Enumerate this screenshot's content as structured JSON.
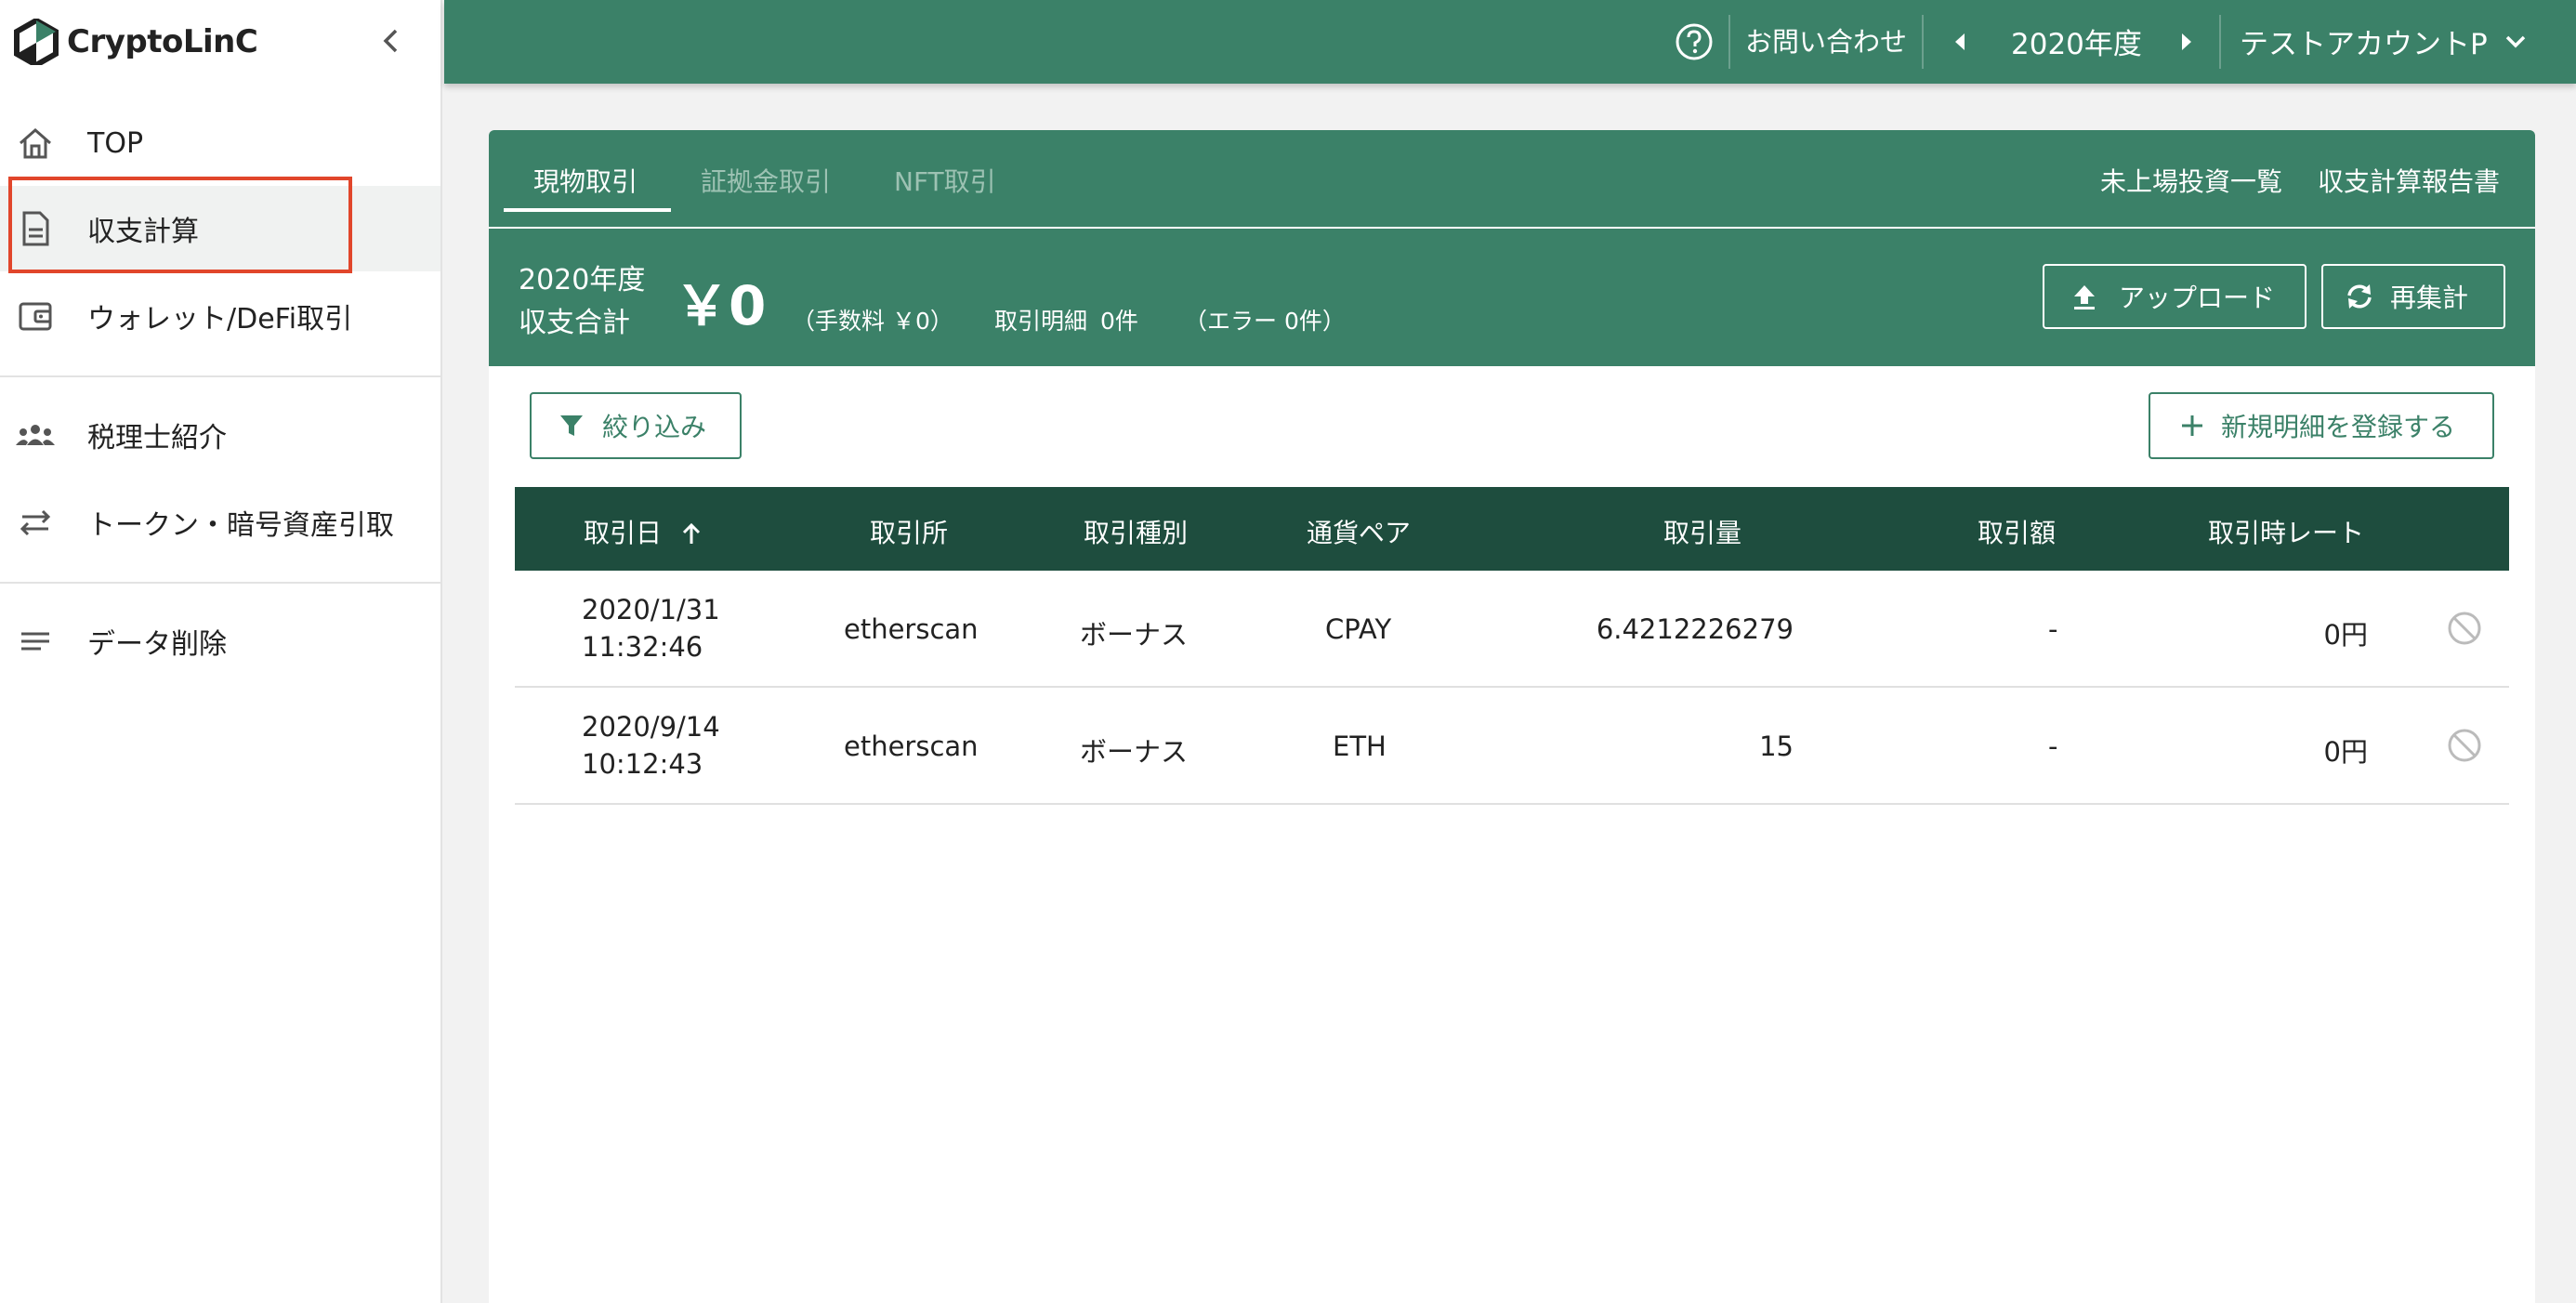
{
  "app": {
    "logo_text": "CryptoLinC"
  },
  "sidebar": {
    "items": [
      {
        "label": "TOP",
        "icon": "home-icon"
      },
      {
        "label": "収支計算",
        "icon": "document-icon"
      },
      {
        "label": "ウォレット/DeFi取引",
        "icon": "wallet-icon"
      },
      {
        "label": "税理士紹介",
        "icon": "people-icon"
      },
      {
        "label": "トークン・暗号資産引取",
        "icon": "swap-icon"
      },
      {
        "label": "データ削除",
        "icon": "lines-icon"
      }
    ],
    "active_item": "収支計算",
    "highlight_color": "#e1462b"
  },
  "topbar": {
    "contact": "お問い合わせ",
    "year": "2020年度",
    "account": "テストアカウントP"
  },
  "tabs": {
    "items": [
      "現物取引",
      "証拠金取引",
      "NFT取引"
    ],
    "active": "現物取引",
    "right_links": [
      "未上場投資一覧",
      "収支計算報告書"
    ]
  },
  "summary": {
    "year_label": "2020年度",
    "total_label": "収支合計",
    "total_value": "￥0",
    "fee_text": "（手数料 ￥0）",
    "count_label": "取引明細",
    "count_value": "0件",
    "error_text": "（エラー 0件）",
    "upload_label": "アップロード",
    "recalc_label": "再集計"
  },
  "actions": {
    "filter_label": "絞り込み",
    "register_label": "新規明細を登録する"
  },
  "table": {
    "headers": [
      "取引日",
      "取引所",
      "取引種別",
      "通貨ペア",
      "取引量",
      "取引額",
      "取引時レート"
    ],
    "rows": [
      {
        "date": "2020/1/31",
        "time": "11:32:46",
        "exchange": "etherscan",
        "type": "ボーナス",
        "pair": "CPAY",
        "amount": "6.4212226279",
        "value": "-",
        "rate": "0円"
      },
      {
        "date": "2020/9/14",
        "time": "10:12:43",
        "exchange": "etherscan",
        "type": "ボーナス",
        "pair": "ETH",
        "amount": "15",
        "value": "-",
        "rate": "0円"
      }
    ]
  },
  "colors": {
    "primary": "#3b8168",
    "header_dark": "#1e4d3e",
    "background": "#f2f2f2"
  }
}
